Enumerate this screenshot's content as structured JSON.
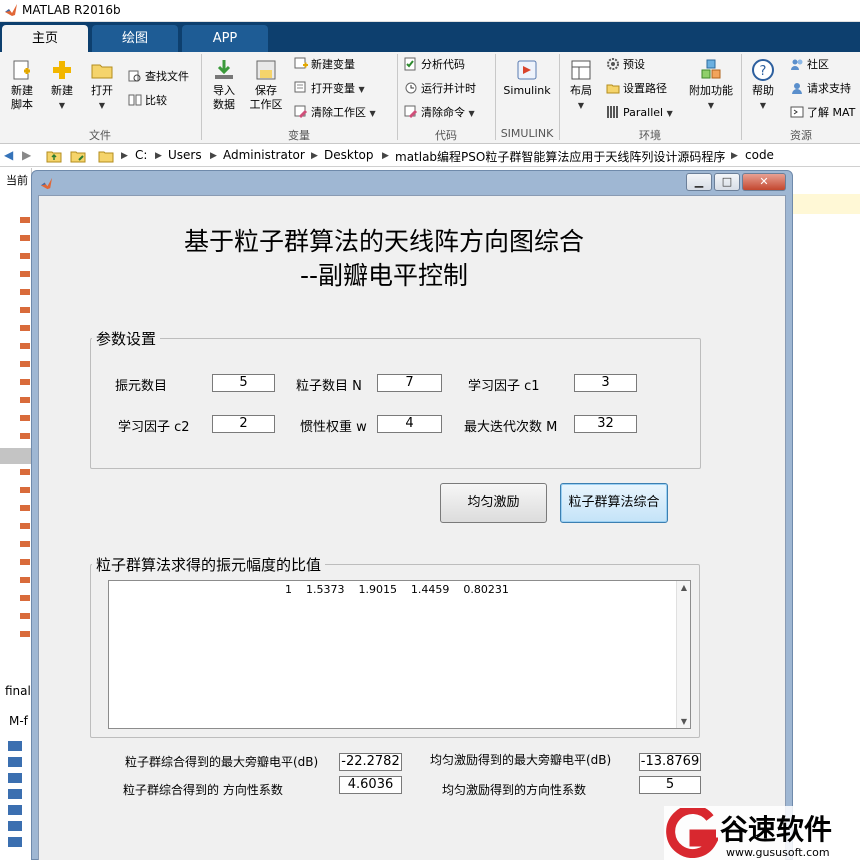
{
  "app": {
    "title": "MATLAB R2016b"
  },
  "tabs": [
    {
      "label": "主页"
    },
    {
      "label": "绘图"
    },
    {
      "label": "APP"
    }
  ],
  "ribbon": {
    "file": {
      "label": "文件",
      "new_script": "新建\n脚本",
      "new": "新建",
      "open": "打开",
      "find_files": "查找文件",
      "compare": "比较"
    },
    "variable": {
      "label": "变量",
      "import": "导入\n数据",
      "save_ws": "保存\n工作区",
      "new_var": "新建变量",
      "open_var": "打开变量",
      "clear_ws": "清除工作区"
    },
    "code": {
      "label": "代码",
      "analyze": "分析代码",
      "run_time": "运行并计时",
      "clear_cmd": "清除命令"
    },
    "simulink": {
      "label": "SIMULINK",
      "simulink": "Simulink"
    },
    "env": {
      "label": "环境",
      "layout": "布局",
      "prefs": "预设",
      "set_path": "设置路径",
      "parallel": "Parallel",
      "addons": "附加功能"
    },
    "resources": {
      "label": "资源",
      "help": "帮助",
      "community": "社区",
      "support": "请求支持",
      "learn": "了解 MAT"
    }
  },
  "address": {
    "crumbs": [
      "C:",
      "Users",
      "Administrator",
      "Desktop",
      "matlab编程PSO粒子群智能算法应用于天线阵列设计源码程序",
      "code"
    ]
  },
  "background": {
    "current_folder": "当前",
    "file_label": "final",
    "mf_label": "M-f"
  },
  "dialog": {
    "heading_line1": "基于粒子群算法的天线阵方向图综合",
    "heading_line2": "--副瓣电平控制",
    "params": {
      "title": "参数设置",
      "elements_label": "振元数目",
      "elements_value": "5",
      "particles_label": "粒子数目 N",
      "particles_value": "7",
      "c1_label": "学习因子 c1",
      "c1_value": "3",
      "c2_label": "学习因子 c2",
      "c2_value": "2",
      "w_label": "惯性权重 w",
      "w_value": "4",
      "iter_label": "最大迭代次数 M",
      "iter_value": "32"
    },
    "buttons": {
      "uniform": "均匀激励",
      "pso": "粒子群算法综合"
    },
    "result": {
      "title": "粒子群算法求得的振元幅度的比值",
      "values": "1    1.5373    1.9015    1.4459    0.80231"
    },
    "stats": {
      "pso_sll_label": "粒子群综合得到的最大旁瓣电平(dB)",
      "pso_sll_value": "-22.2782",
      "uni_sll_label": "均匀激励得到的最大旁瓣电平(dB)",
      "uni_sll_value": "-13.8769",
      "pso_dir_label": "粒子群综合得到的  方向性系数",
      "pso_dir_value": "4.6036",
      "uni_dir_label": "均匀激励得到的方向性系数",
      "uni_dir_value": "5"
    }
  },
  "watermark": {
    "brand": "谷速软件",
    "url": "www.gususoft.com"
  },
  "colors": {
    "tab_strip": "#0d3f6e",
    "ribbon_bg": "#f3f3f3",
    "dialog_frame": "#9fb7d3",
    "client_bg": "#f0f0f0",
    "watermark_red": "#d8282f"
  }
}
